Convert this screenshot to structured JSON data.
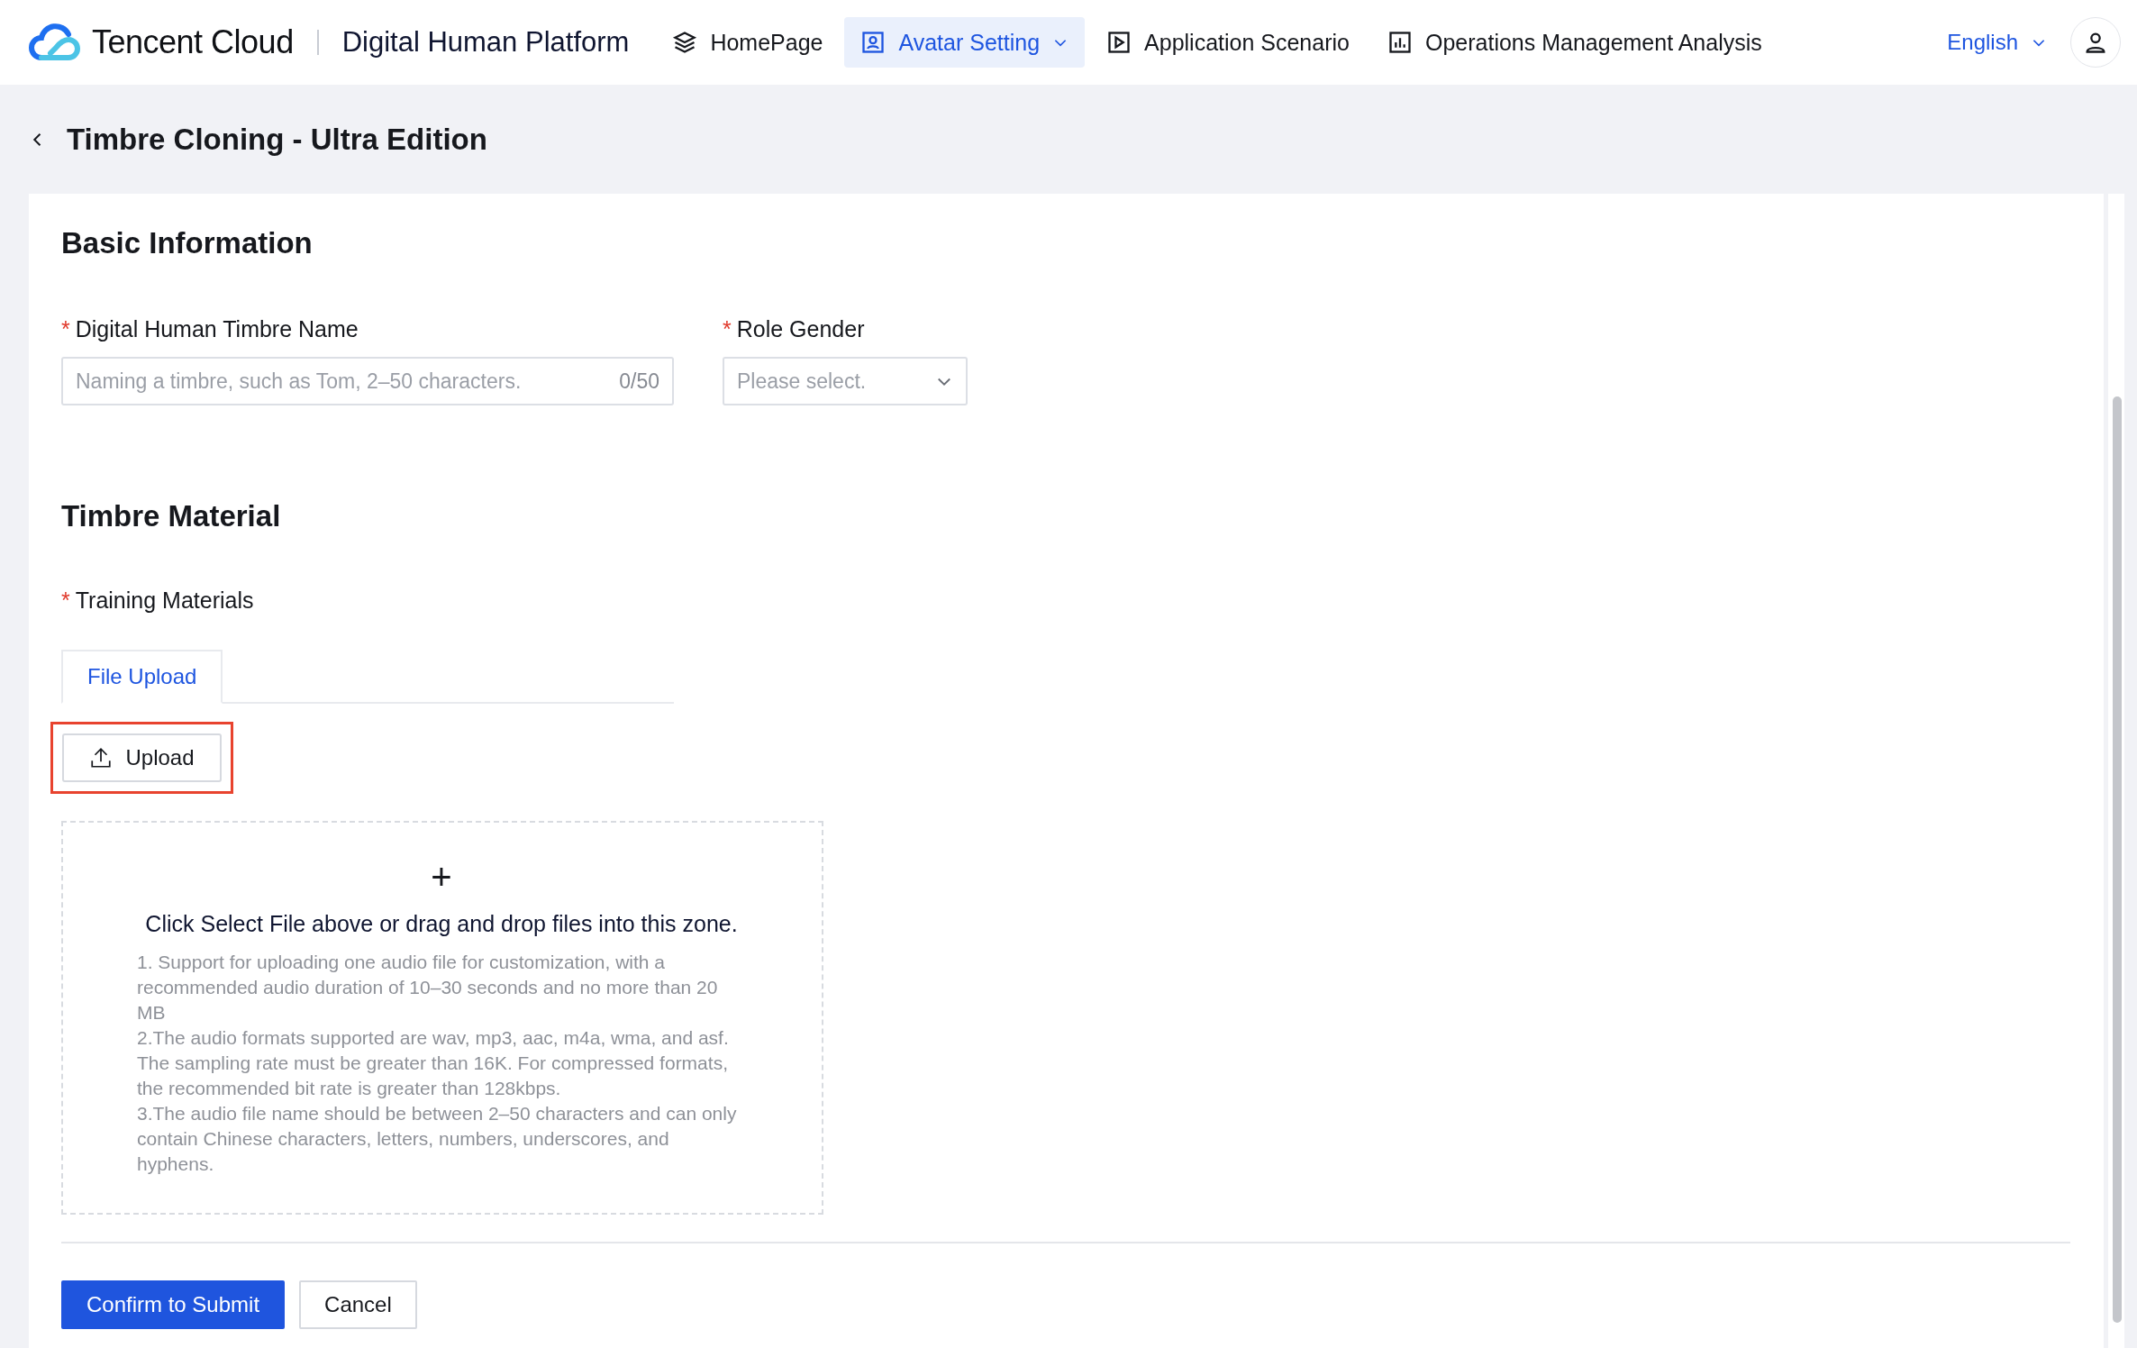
{
  "header": {
    "brand": "Tencent Cloud",
    "product": "Digital Human Platform",
    "nav": [
      {
        "label": "HomePage",
        "selected": false,
        "has_menu": false
      },
      {
        "label": "Avatar Setting",
        "selected": true,
        "has_menu": true
      },
      {
        "label": "Application Scenario",
        "selected": false,
        "has_menu": false
      },
      {
        "label": "Operations Management Analysis",
        "selected": false,
        "has_menu": false
      }
    ],
    "language": "English"
  },
  "page_title": "Timbre Cloning - Ultra Edition",
  "basic_info": {
    "title": "Basic Information",
    "fields": [
      {
        "kind": "text",
        "label": "Digital Human Timbre Name",
        "required_mark": "*",
        "placeholder": "Naming a timbre, such as Tom, 2–50 characters.",
        "counter": "0/50"
      },
      {
        "kind": "select",
        "label": "Role Gender",
        "required_mark": "*",
        "placeholder": "Please select."
      }
    ]
  },
  "material": {
    "title": "Timbre Material",
    "label": "Training Materials",
    "required_mark": "*",
    "tabs": [
      {
        "label": "File Upload",
        "selected": true
      }
    ],
    "upload_button": {
      "label": "Upload",
      "highlighted": true
    },
    "dropzone": {
      "plus": "+",
      "prompt": "Click Select File above or drag and drop files into this zone.",
      "notes": [
        "1. Support for uploading one audio file for customization, with a recommended audio duration of 10–30 seconds and no more than 20 MB",
        "2.The audio formats supported are wav, mp3, aac, m4a, wma, and asf. The sampling rate must be greater than 16K. For compressed formats, the recommended bit rate is greater than 128kbps.",
        "3.The audio file name should be between 2–50 characters and can only contain Chinese characters, letters, numbers, underscores, and hyphens."
      ]
    }
  },
  "actions": [
    {
      "kind": "primary",
      "label": "Confirm to Submit"
    },
    {
      "kind": "secondary",
      "label": "Cancel"
    }
  ]
}
